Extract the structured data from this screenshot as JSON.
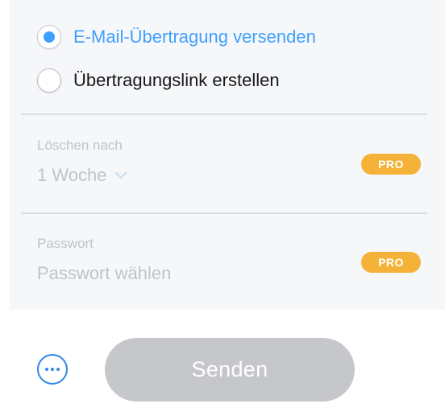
{
  "transfer_options": {
    "email_option_label": "E-Mail-Übertragung versenden",
    "email_option_selected": true,
    "link_option_label": "Übertragungslink erstellen",
    "link_option_selected": false
  },
  "expiry": {
    "label": "Löschen nach",
    "value": "1 Woche",
    "badge": "PRO"
  },
  "password": {
    "label": "Passwort",
    "placeholder": "Passwort wählen",
    "badge": "PRO"
  },
  "footer": {
    "send_label": "Senden",
    "more_icon": "ellipsis-circle-icon"
  },
  "colors": {
    "accent": "#409fff",
    "pro_badge": "#f4b338",
    "send_disabled": "#c5c7ca",
    "panel_bg": "#f6f7f8"
  }
}
